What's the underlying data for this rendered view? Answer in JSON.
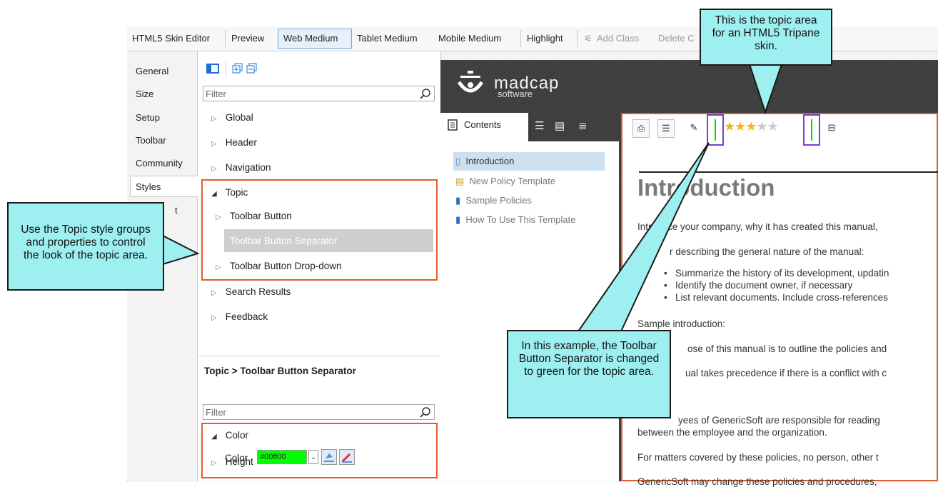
{
  "toolbar": {
    "items": [
      "HTML5 Skin Editor",
      "Preview",
      "Web Medium",
      "Tablet Medium",
      "Mobile Medium",
      "Highlight",
      "Add Class",
      "Delete C"
    ]
  },
  "side_tabs": [
    "General",
    "Size",
    "Setup",
    "Toolbar",
    "Community",
    "Styles",
    "t"
  ],
  "tree": {
    "filter_placeholder": "Filter",
    "items": [
      "Global",
      "Header",
      "Navigation",
      "Topic",
      "Toolbar Button",
      "Toolbar Button Separator",
      "Toolbar Button Drop-down",
      "Search Results",
      "Feedback"
    ]
  },
  "props": {
    "breadcrumb": "Topic > Toolbar Button Separator",
    "filter_placeholder": "Filter",
    "group": "Color",
    "color_label": "Color",
    "color_value": "#00ff00",
    "height_label": "Height"
  },
  "preview": {
    "logo_main": "madcap",
    "logo_sub": "software",
    "tab_label": "Contents",
    "nav_items": [
      "Introduction",
      "New Policy Template",
      "Sample Policies",
      "How To Use This Template"
    ],
    "heading": "Introduction",
    "lines": [
      "Introduce your company, why it has created this manual,",
      "r describing the general nature of the manual:",
      "Summarize the history of its development, updatin",
      "Identify the document owner, if necessary",
      "List relevant documents. Include cross-references",
      "Sample introduction:",
      "ose of this manual is to outline the policies and",
      "ual takes precedence if there is a conflict with c",
      "yees of GenericSoft are responsible for reading",
      "between the employee and the organization.",
      "For matters covered by these policies, no person, other t",
      "GenericSoft may change these policies and procedures,"
    ],
    "stars": 3
  },
  "callouts": {
    "top": "This is the topic area for an HTML5 Tripane skin.",
    "left": "Use the Topic style groups and properties to control the look of the topic area.",
    "bottom": "In this example, the Toolbar Button Separator is changed to green for the topic area."
  },
  "colors": {
    "highlight": "#e35d2b",
    "callout": "#9eeff0",
    "separator": "#00ff00",
    "purple": "#7a3fcf"
  }
}
